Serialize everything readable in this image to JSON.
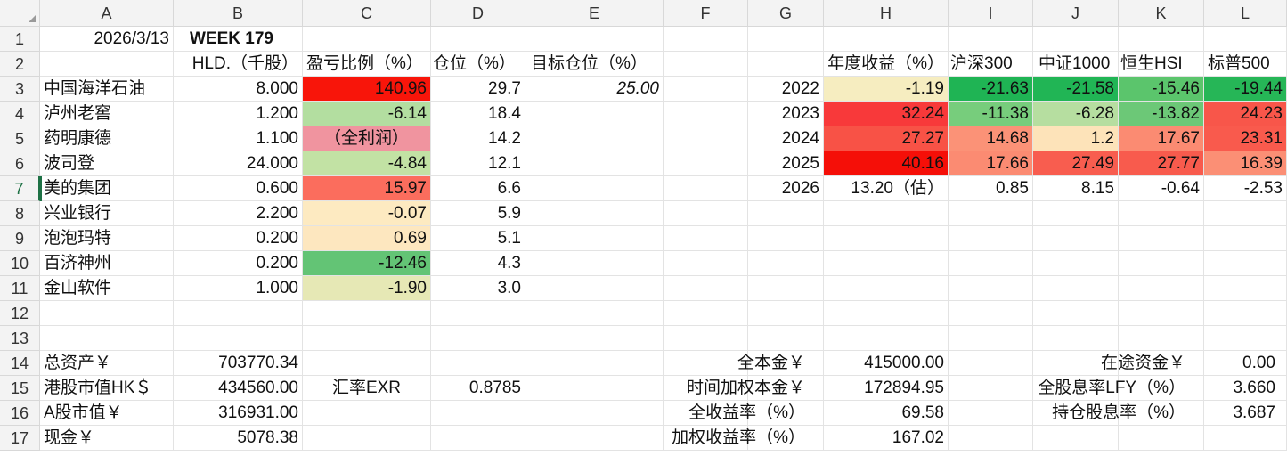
{
  "columns": [
    "A",
    "B",
    "C",
    "D",
    "E",
    "F",
    "G",
    "H",
    "I",
    "J",
    "K",
    "L"
  ],
  "rows": [
    "1",
    "2",
    "3",
    "4",
    "5",
    "6",
    "7",
    "8",
    "9",
    "10",
    "11",
    "12",
    "13",
    "14",
    "15",
    "16",
    "17"
  ],
  "header": {
    "date": "2026/3/13",
    "week": "WEEK 179",
    "hld": "HLD.（千股）",
    "pnl": "盈亏比例（%）",
    "position": "仓位（%）",
    "target": "目标仓位（%）",
    "annual": "年度收益（%）",
    "hs300": "沪深300",
    "zz1000": "中证1000",
    "hsi": "恒生HSI",
    "sp500": "标普500"
  },
  "holdings": [
    {
      "name": "中国海洋石油",
      "hld": "8.000",
      "pnl": "140.96",
      "pos": "29.7",
      "target": "25.00",
      "pnl_color": "#f8150a"
    },
    {
      "name": "泸州老窖",
      "hld": "1.200",
      "pnl": "-6.14",
      "pos": "18.4",
      "target": "",
      "pnl_color": "#b3dea0"
    },
    {
      "name": "药明康德",
      "hld": "1.100",
      "pnl": "（全利润）",
      "pos": "14.2",
      "target": "",
      "pnl_color": "#f0949f"
    },
    {
      "name": "波司登",
      "hld": "24.000",
      "pnl": "-4.84",
      "pos": "12.1",
      "target": "",
      "pnl_color": "#c2e2a4"
    },
    {
      "name": "美的集团",
      "hld": "0.600",
      "pnl": "15.97",
      "pos": "6.6",
      "target": "",
      "pnl_color": "#fb6d5d"
    },
    {
      "name": "兴业银行",
      "hld": "2.200",
      "pnl": "-0.07",
      "pos": "5.9",
      "target": "",
      "pnl_color": "#fdeac1"
    },
    {
      "name": "泡泡玛特",
      "hld": "0.200",
      "pnl": "0.69",
      "pos": "5.1",
      "target": "",
      "pnl_color": "#fde7bf"
    },
    {
      "name": "百济神州",
      "hld": "0.200",
      "pnl": "-12.46",
      "pos": "4.3",
      "target": "",
      "pnl_color": "#63c475"
    },
    {
      "name": "金山软件",
      "hld": "1.000",
      "pnl": "-1.90",
      "pos": "3.0",
      "target": "",
      "pnl_color": "#e6e8b5"
    }
  ],
  "yearly": [
    {
      "year": "2022",
      "annual": "-1.19",
      "hs300": "-21.63",
      "zz1000": "-21.58",
      "hsi": "-15.46",
      "sp500": "-19.44",
      "colors": [
        "#f6edc0",
        "#1fb454",
        "#21b555",
        "#5bc56c",
        "#26b657"
      ]
    },
    {
      "year": "2023",
      "annual": "32.24",
      "hs300": "-11.38",
      "zz1000": "-6.28",
      "hsi": "-13.82",
      "sp500": "24.23",
      "colors": [
        "#f8393a",
        "#77cd7c",
        "#b6dea0",
        "#6cc877",
        "#f8564a"
      ]
    },
    {
      "year": "2024",
      "annual": "27.27",
      "hs300": "14.68",
      "zz1000": "1.2",
      "hsi": "17.67",
      "sp500": "23.31",
      "colors": [
        "#f85246",
        "#fb9277",
        "#fde3b9",
        "#fb8b72",
        "#f95a4d"
      ]
    },
    {
      "year": "2025",
      "annual": "40.16",
      "hs300": "17.66",
      "zz1000": "27.49",
      "hsi": "27.77",
      "sp500": "16.39",
      "colors": [
        "#f50f08",
        "#fb8b72",
        "#f85d4f",
        "#f85b4d",
        "#fb8f75"
      ]
    },
    {
      "year": "2026",
      "annual": "13.20（估）",
      "hs300": "0.85",
      "zz1000": "8.15",
      "hsi": "-0.64",
      "sp500": "-2.53",
      "colors": [
        "#ffffff",
        "#ffffff",
        "#ffffff",
        "#ffffff",
        "#ffffff"
      ]
    }
  ],
  "summary_left": [
    {
      "label": "总资产￥",
      "value": "703770.34"
    },
    {
      "label": "港股市值HK＄",
      "value": "434560.00"
    },
    {
      "label": "A股市值￥",
      "value": "316931.00"
    },
    {
      "label": "现金￥",
      "value": "5078.38"
    }
  ],
  "exr": {
    "label": "汇率EXR",
    "value": "0.8785"
  },
  "summary_mid": [
    {
      "label": "全本金￥",
      "value": "415000.00"
    },
    {
      "label": "时间加权本金￥",
      "value": "172894.95"
    },
    {
      "label": "全收益率（%）",
      "value": "69.58"
    },
    {
      "label": "加权收益率（%）",
      "value": "167.02"
    }
  ],
  "summary_right": [
    {
      "label": "在途资金￥",
      "value": "0.00"
    },
    {
      "label": "全股息率LFY（%）",
      "value": "3.660"
    },
    {
      "label": "持仓股息率（%）",
      "value": "3.687"
    }
  ]
}
